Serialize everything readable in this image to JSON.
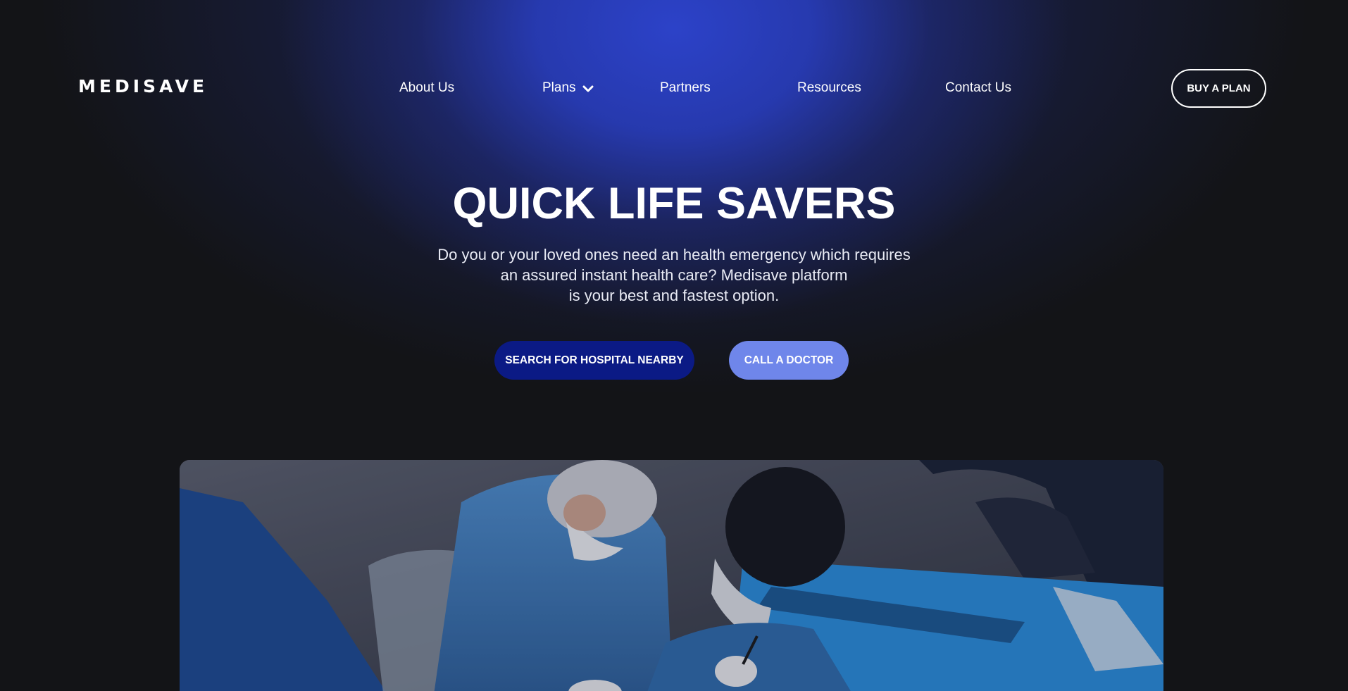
{
  "brand": {
    "logo_text": "MEDISAVE"
  },
  "nav": {
    "items": [
      {
        "label": "About Us"
      },
      {
        "label": "Plans",
        "has_dropdown": true
      },
      {
        "label": "Partners"
      },
      {
        "label": "Resources"
      },
      {
        "label": "Contact Us"
      }
    ],
    "cta_label": "BUY A PLAN"
  },
  "hero": {
    "title": "QUICK LIFE SAVERS",
    "subtitle_lines": [
      "Do you or your loved ones need an health emergency which requires",
      "an assured instant health care? Medisave platform",
      "is your best and fastest option."
    ],
    "primary_button": "SEARCH FOR HOSPITAL NEARBY",
    "secondary_button": "CALL A DOCTOR"
  },
  "media": {
    "photo_subject": "surgeons operating in a theatre"
  },
  "colors": {
    "background": "#131417",
    "glow": "#2c42c8",
    "primary_button": "#0b1a85",
    "secondary_button": "#6f86ea"
  },
  "icons": {
    "plans_dropdown": "chevron-down-icon"
  }
}
